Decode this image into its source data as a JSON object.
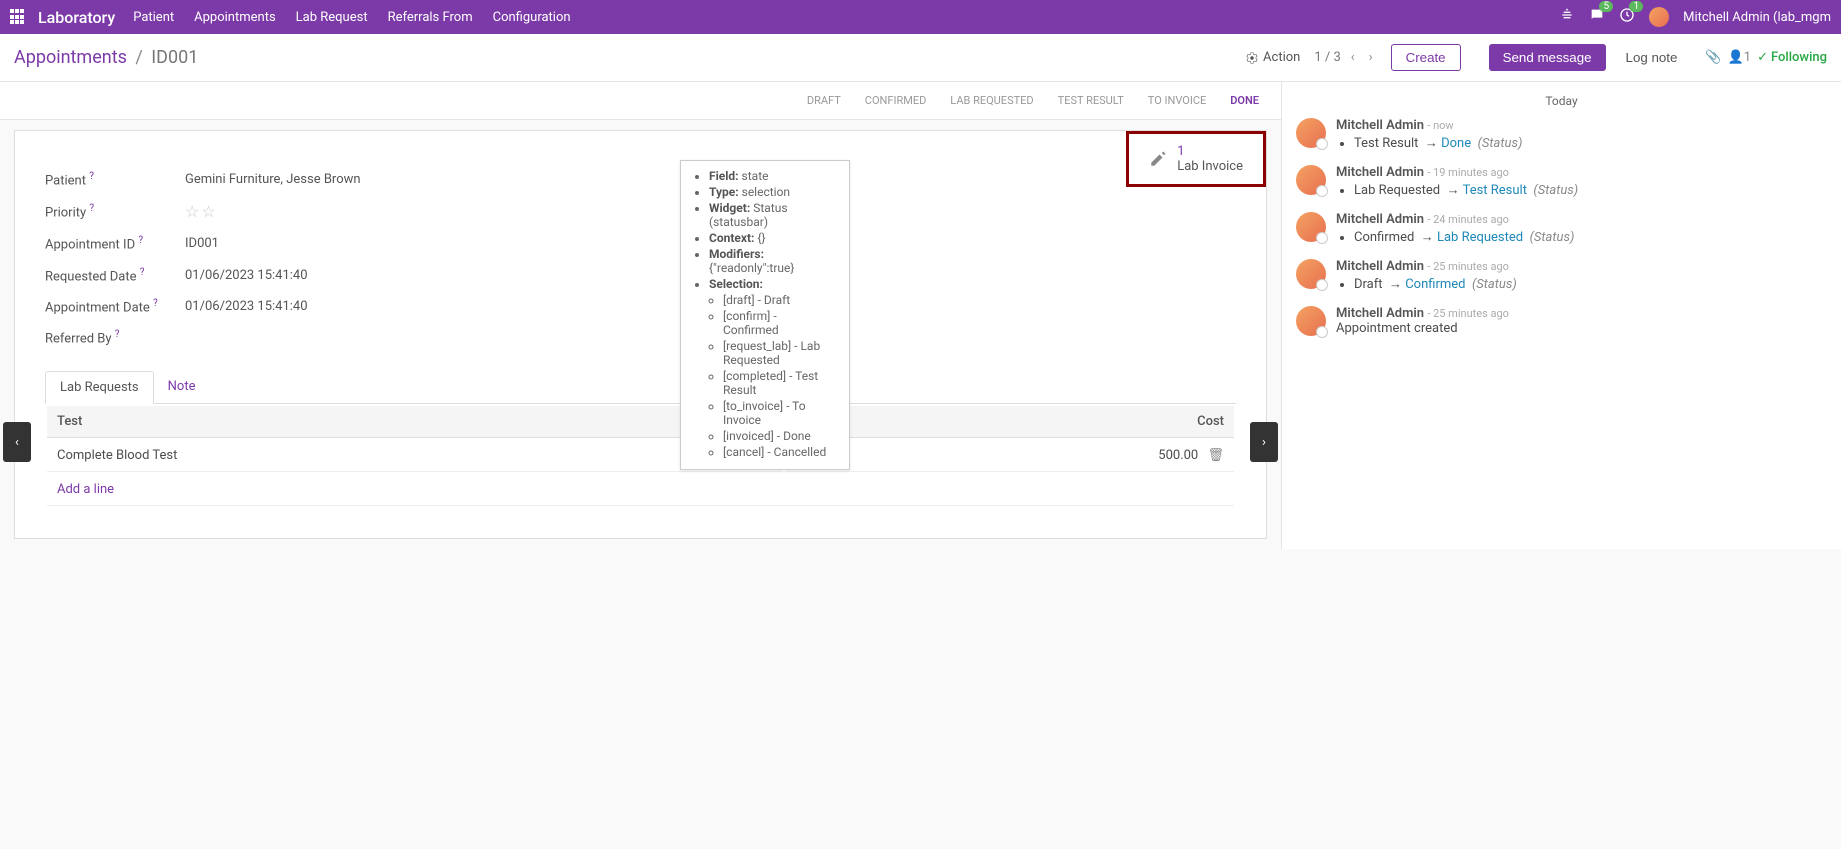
{
  "topbar": {
    "brand": "Laboratory",
    "nav": [
      "Patient",
      "Appointments",
      "Lab Request",
      "Referrals From",
      "Configuration"
    ],
    "msg_count": "5",
    "activity_count": "1",
    "user": "Mitchell Admin (lab_mgm"
  },
  "header": {
    "bc_root": "Appointments",
    "bc_cur": "ID001",
    "action": "Action",
    "pager": "1 / 3",
    "create": "Create"
  },
  "statusbar": {
    "steps": [
      "DRAFT",
      "CONFIRMED",
      "LAB REQUESTED",
      "TEST RESULT",
      "TO INVOICE",
      "DONE"
    ],
    "active_index": 5
  },
  "statbtn": {
    "num": "1",
    "label": "Lab Invoice"
  },
  "fields": {
    "patient_label": "Patient",
    "patient": "Gemini Furniture, Jesse Brown",
    "priority_label": "Priority",
    "apptid_label": "Appointment ID",
    "apptid": "ID001",
    "reqdate_label": "Requested Date",
    "reqdate": "01/06/2023 15:41:40",
    "apptdate_label": "Appointment Date",
    "apptdate": "01/06/2023 15:41:40",
    "refby_label": "Referred By"
  },
  "tabs": {
    "t1": "Lab Requests",
    "t2": "Note"
  },
  "table": {
    "h_test": "Test",
    "h_cost": "Cost",
    "rows": [
      {
        "test": "Complete Blood Test",
        "cost": "500.00"
      }
    ],
    "addline": "Add a line"
  },
  "tooltip": {
    "field_l": "Field:",
    "field_v": "state",
    "type_l": "Type:",
    "type_v": "selection",
    "widget_l": "Widget:",
    "widget_v": "Status (statusbar)",
    "context_l": "Context:",
    "context_v": "{}",
    "modifiers_l": "Modifiers:",
    "modifiers_v": "{\"readonly\":true}",
    "selection_l": "Selection:",
    "selection": [
      "[draft] - Draft",
      "[confirm] - Confirmed",
      "[request_lab] - Lab Requested",
      "[completed] - Test Result",
      "[to_invoice] - To Invoice",
      "[invoiced] - Done",
      "[cancel] - Cancelled"
    ]
  },
  "chatter": {
    "send": "Send message",
    "lognote": "Log note",
    "follow_count": "1",
    "following": "Following",
    "today": "Today",
    "messages": [
      {
        "name": "Mitchell Admin",
        "time": "now",
        "from": "Test Result",
        "to": "Done",
        "field": "(Status)"
      },
      {
        "name": "Mitchell Admin",
        "time": "19 minutes ago",
        "from": "Lab Requested",
        "to": "Test Result",
        "field": "(Status)"
      },
      {
        "name": "Mitchell Admin",
        "time": "24 minutes ago",
        "from": "Confirmed",
        "to": "Lab Requested",
        "field": "(Status)"
      },
      {
        "name": "Mitchell Admin",
        "time": "25 minutes ago",
        "from": "Draft",
        "to": "Confirmed",
        "field": "(Status)"
      },
      {
        "name": "Mitchell Admin",
        "time": "25 minutes ago",
        "text": "Appointment created"
      }
    ]
  }
}
